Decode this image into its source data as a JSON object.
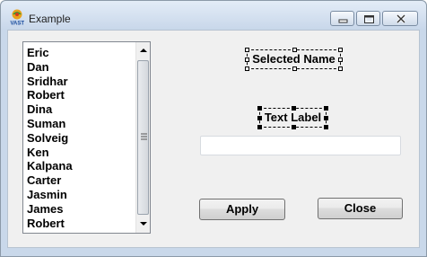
{
  "window": {
    "title": "Example",
    "icon": "vast-app-icon",
    "controls": [
      "minimize-icon",
      "maximize-icon",
      "close-icon"
    ]
  },
  "names_list": {
    "items": [
      "Eric",
      "Dan",
      "Sridhar",
      "Robert",
      "Dina",
      "Suman",
      "Solveig",
      "Ken",
      "Kalpana",
      "Carter",
      "Jasmin",
      "James",
      "Robert"
    ]
  },
  "labels": {
    "selected_name": "Selected Name",
    "text_label": "Text Label"
  },
  "text_input": {
    "value": ""
  },
  "buttons": {
    "apply": "Apply",
    "close": "Close"
  }
}
